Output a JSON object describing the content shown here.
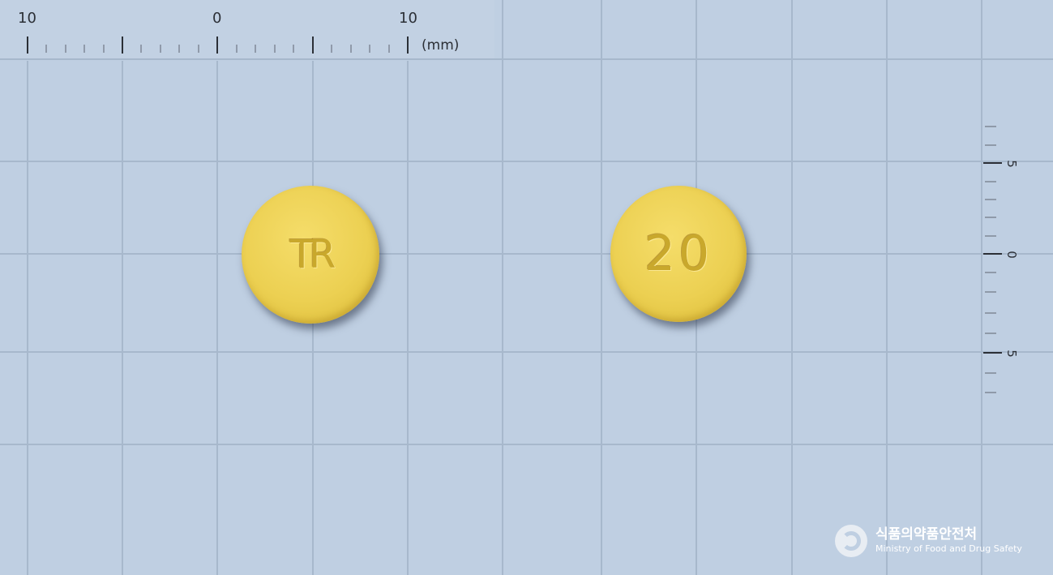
{
  "ruler_top": {
    "labels": [
      "10",
      "0",
      "10"
    ],
    "unit": "(mm)"
  },
  "ruler_right": {
    "labels": [
      "5",
      "0",
      "5"
    ]
  },
  "pills": [
    {
      "imprint": "TR",
      "color": "#ecd052"
    },
    {
      "imprint": "20",
      "color": "#ecd052"
    }
  ],
  "logo": {
    "name_korean": "식품의약품안전처",
    "name_english": "Ministry of Food and Drug Safety"
  }
}
